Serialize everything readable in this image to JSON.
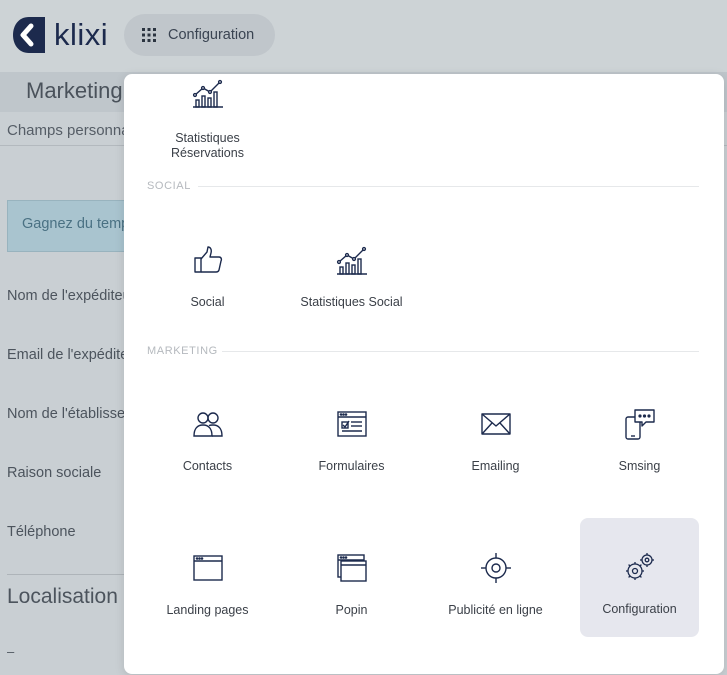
{
  "header": {
    "logo_text": "klixi",
    "config_button_label": "Configuration"
  },
  "page": {
    "title": "Marketing :",
    "subnav_item": "Champs personna",
    "info_text": "Gagnez du temp",
    "fields": [
      "Nom de l'expéditeu",
      "Email de l'expédite",
      "Nom de l'établissen",
      "Raison sociale",
      "Téléphone"
    ],
    "section_title": "Localisation",
    "dash": "–"
  },
  "menu": {
    "top_item_label": "Statistiques Réservations",
    "social_label": "SOCIAL",
    "social_items": [
      "Social",
      "Statistiques Social"
    ],
    "marketing_label": "MARKETING",
    "marketing_items": [
      "Contacts",
      "Formulaires",
      "Emailing",
      "Smsing",
      "Landing pages",
      "Popin",
      "Publicité en ligne",
      "Configuration"
    ]
  },
  "colors": {
    "brand_navy": "#1c2a4d",
    "active_tile_bg": "#e6e7ee"
  }
}
